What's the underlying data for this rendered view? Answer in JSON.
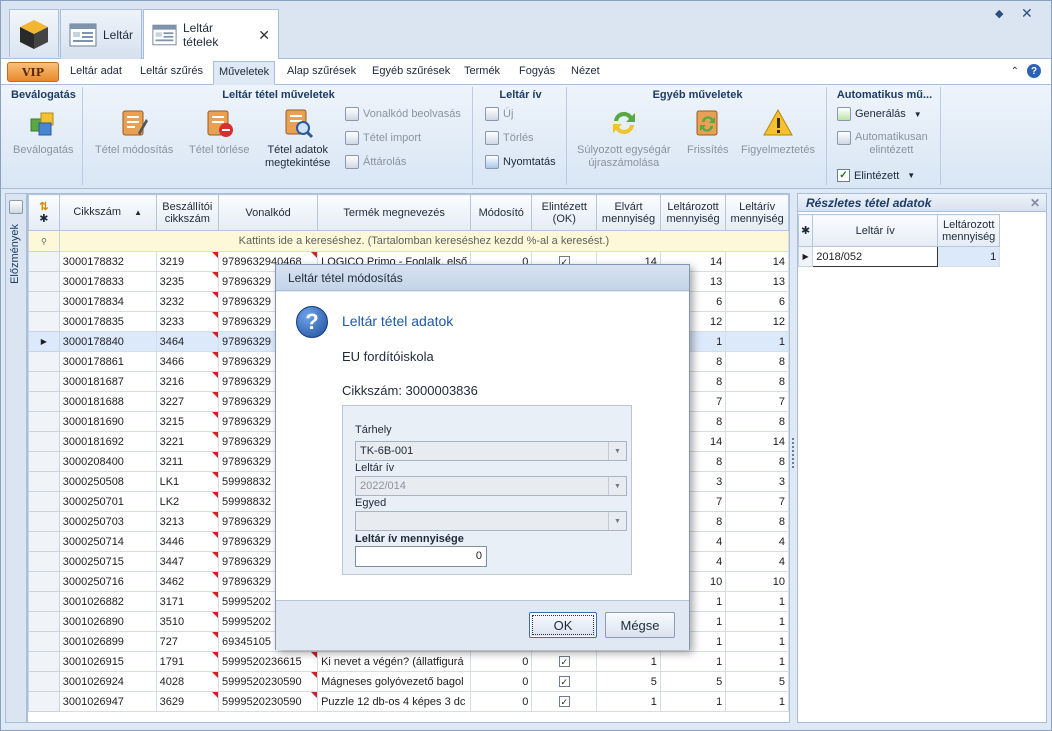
{
  "window": {
    "doc_tabs": [
      {
        "label": "Leltár"
      },
      {
        "label": "Leltár tételek",
        "close": "✕"
      }
    ],
    "controls": {
      "pin": "◆",
      "close": "✕"
    }
  },
  "ribbon_tabs": {
    "vip": "VIP",
    "items": [
      "Leltár adat",
      "Leltár szűrés",
      "Műveletek",
      "Alap szűrések",
      "Egyéb szűrések",
      "Termék",
      "Fogyás",
      "Nézet"
    ],
    "active_index": 2
  },
  "ribbon": {
    "groups": [
      {
        "title": "Beválogatás"
      },
      {
        "title": "Leltár tétel műveletek"
      },
      {
        "title": "Leltár ív"
      },
      {
        "title": "Egyéb műveletek"
      },
      {
        "title": "Automatikus mű..."
      }
    ],
    "buttons": {
      "bevalogatas": "Beválogatás",
      "tetel_modositas": "Tétel módosítás",
      "tetel_torlese": "Tétel törlése",
      "tetel_adatok_1": "Tétel adatok",
      "tetel_adatok_2": "megtekintése",
      "vonalkod_beolvasas": "Vonalkód beolvasás",
      "tetel_import": "Tétel import",
      "attarolas": "Áttárolás",
      "uj": "Új",
      "torles": "Törlés",
      "nyomtatas": "Nyomtatás",
      "sulyozott_1": "Súlyozott egységár",
      "sulyozott_2": "újraszámolása",
      "frissites": "Frissítés",
      "figyelmeztetes": "Figyelmeztetés",
      "generalas": "Generálás",
      "auto_elintezett_1": "Automatikusan",
      "auto_elintezett_2": "elintézett",
      "elintezett": "Elintézett"
    }
  },
  "side_strip": {
    "label": "Előzmények"
  },
  "grid": {
    "headers": {
      "cikkszam": "Cikkszám",
      "beszallitoi_1": "Beszállítói",
      "beszallitoi_2": "cikkszám",
      "vonalkod": "Vonalkód",
      "termek": "Termék megnevezés",
      "modosito": "Módosító",
      "elintezett_1": "Elintézett",
      "elintezett_2": "(OK)",
      "elvart_1": "Elvárt",
      "elvart_2": "mennyiség",
      "leltarozott_1": "Leltározott",
      "leltarozott_2": "mennyiség",
      "leltariv_1": "Leltárív",
      "leltariv_2": "mennyiség"
    },
    "search_hint": "Kattints ide a kereséshez. (Tartalomban kereséshez kezdd %-al a keresést.)",
    "rows": [
      {
        "cikkszam": "3000178832",
        "besz": "3219",
        "vonalkod": "9789632940468",
        "termek": "LOGICO Primo - Foglalk. első",
        "mod": "0",
        "ok": "✓",
        "elvart": "14",
        "leltarozott": "14",
        "leltariv": "14"
      },
      {
        "cikkszam": "3000178833",
        "besz": "3235",
        "vonalkod": "97896329",
        "termek": "",
        "mod": "",
        "ok": "",
        "elvart": "",
        "leltarozott": "13",
        "leltariv": "13"
      },
      {
        "cikkszam": "3000178834",
        "besz": "3232",
        "vonalkod": "97896329",
        "termek": "",
        "mod": "",
        "ok": "",
        "elvart": "",
        "leltarozott": "6",
        "leltariv": "6"
      },
      {
        "cikkszam": "3000178835",
        "besz": "3233",
        "vonalkod": "97896329",
        "termek": "",
        "mod": "",
        "ok": "",
        "elvart": "",
        "leltarozott": "12",
        "leltariv": "12"
      },
      {
        "cikkszam": "3000178840",
        "besz": "3464",
        "vonalkod": "97896329",
        "termek": "",
        "mod": "",
        "ok": "",
        "elvart": "",
        "leltarozott": "1",
        "leltariv": "1",
        "selected": true
      },
      {
        "cikkszam": "3000178861",
        "besz": "3466",
        "vonalkod": "97896329",
        "termek": "",
        "mod": "",
        "ok": "",
        "elvart": "",
        "leltarozott": "8",
        "leltariv": "8"
      },
      {
        "cikkszam": "3000181687",
        "besz": "3216",
        "vonalkod": "97896329",
        "termek": "",
        "mod": "",
        "ok": "",
        "elvart": "",
        "leltarozott": "8",
        "leltariv": "8"
      },
      {
        "cikkszam": "3000181688",
        "besz": "3227",
        "vonalkod": "97896329",
        "termek": "",
        "mod": "",
        "ok": "",
        "elvart": "",
        "leltarozott": "7",
        "leltariv": "7"
      },
      {
        "cikkszam": "3000181690",
        "besz": "3215",
        "vonalkod": "97896329",
        "termek": "",
        "mod": "",
        "ok": "",
        "elvart": "",
        "leltarozott": "8",
        "leltariv": "8"
      },
      {
        "cikkszam": "3000181692",
        "besz": "3221",
        "vonalkod": "97896329",
        "termek": "",
        "mod": "",
        "ok": "",
        "elvart": "",
        "leltarozott": "14",
        "leltariv": "14"
      },
      {
        "cikkszam": "3000208400",
        "besz": "3211",
        "vonalkod": "97896329",
        "termek": "",
        "mod": "",
        "ok": "",
        "elvart": "",
        "leltarozott": "8",
        "leltariv": "8"
      },
      {
        "cikkszam": "3000250508",
        "besz": "LK1",
        "vonalkod": "59998832",
        "termek": "",
        "mod": "",
        "ok": "",
        "elvart": "",
        "leltarozott": "3",
        "leltariv": "3"
      },
      {
        "cikkszam": "3000250701",
        "besz": "LK2",
        "vonalkod": "59998832",
        "termek": "",
        "mod": "",
        "ok": "",
        "elvart": "",
        "leltarozott": "7",
        "leltariv": "7"
      },
      {
        "cikkszam": "3000250703",
        "besz": "3213",
        "vonalkod": "97896329",
        "termek": "",
        "mod": "",
        "ok": "",
        "elvart": "",
        "leltarozott": "8",
        "leltariv": "8"
      },
      {
        "cikkszam": "3000250714",
        "besz": "3446",
        "vonalkod": "97896329",
        "termek": "",
        "mod": "",
        "ok": "",
        "elvart": "",
        "leltarozott": "4",
        "leltariv": "4"
      },
      {
        "cikkszam": "3000250715",
        "besz": "3447",
        "vonalkod": "97896329",
        "termek": "",
        "mod": "",
        "ok": "",
        "elvart": "",
        "leltarozott": "4",
        "leltariv": "4"
      },
      {
        "cikkszam": "3000250716",
        "besz": "3462",
        "vonalkod": "97896329",
        "termek": "",
        "mod": "",
        "ok": "",
        "elvart": "",
        "leltarozott": "10",
        "leltariv": "10"
      },
      {
        "cikkszam": "3001026882",
        "besz": "3171",
        "vonalkod": "59995202",
        "termek": "",
        "mod": "",
        "ok": "",
        "elvart": "",
        "leltarozott": "1",
        "leltariv": "1"
      },
      {
        "cikkszam": "3001026890",
        "besz": "3510",
        "vonalkod": "59995202",
        "termek": "",
        "mod": "",
        "ok": "",
        "elvart": "",
        "leltarozott": "1",
        "leltariv": "1"
      },
      {
        "cikkszam": "3001026899",
        "besz": "727",
        "vonalkod": "69345105",
        "termek": "",
        "mod": "",
        "ok": "",
        "elvart": "",
        "leltarozott": "1",
        "leltariv": "1"
      },
      {
        "cikkszam": "3001026915",
        "besz": "1791",
        "vonalkod": "5999520236615",
        "termek": "Ki nevet a végén? (állatfigurá",
        "mod": "0",
        "ok": "✓",
        "elvart": "1",
        "leltarozott": "1",
        "leltariv": "1"
      },
      {
        "cikkszam": "3001026924",
        "besz": "4028",
        "vonalkod": "5999520230590",
        "termek": "Mágneses golyóvezető bagol",
        "mod": "0",
        "ok": "✓",
        "elvart": "5",
        "leltarozott": "5",
        "leltariv": "5"
      },
      {
        "cikkszam": "3001026947",
        "besz": "3629",
        "vonalkod": "5999520230590",
        "termek": "Puzzle 12 db-os 4 képes 3 dc",
        "mod": "0",
        "ok": "✓",
        "elvart": "1",
        "leltarozott": "1",
        "leltariv": "1"
      }
    ]
  },
  "right_panel": {
    "title": "Részletes tétel adatok",
    "close": "✕",
    "headers": {
      "leltar_iv": "Leltár ív",
      "leltarozott_1": "Leltározott",
      "leltarozott_2": "mennyiség"
    },
    "rows": [
      {
        "leltar_iv": "2018/052",
        "menny": "1"
      }
    ]
  },
  "dialog": {
    "title": "Leltár tétel módosítás",
    "heading": "Leltár tétel adatok",
    "line1": "EU fordítóiskola",
    "line2": "Cikkszám: 3000003836",
    "tarhely_label": "Tárhely",
    "tarhely_value": "TK-6B-001",
    "leltariv_label": "Leltár ív",
    "leltariv_value": "2022/014",
    "egyed_label": "Egyed",
    "egyed_value": "",
    "menny_label": "Leltár ív mennyisége",
    "menny_value": "0",
    "ok": "OK",
    "cancel": "Mégse"
  }
}
